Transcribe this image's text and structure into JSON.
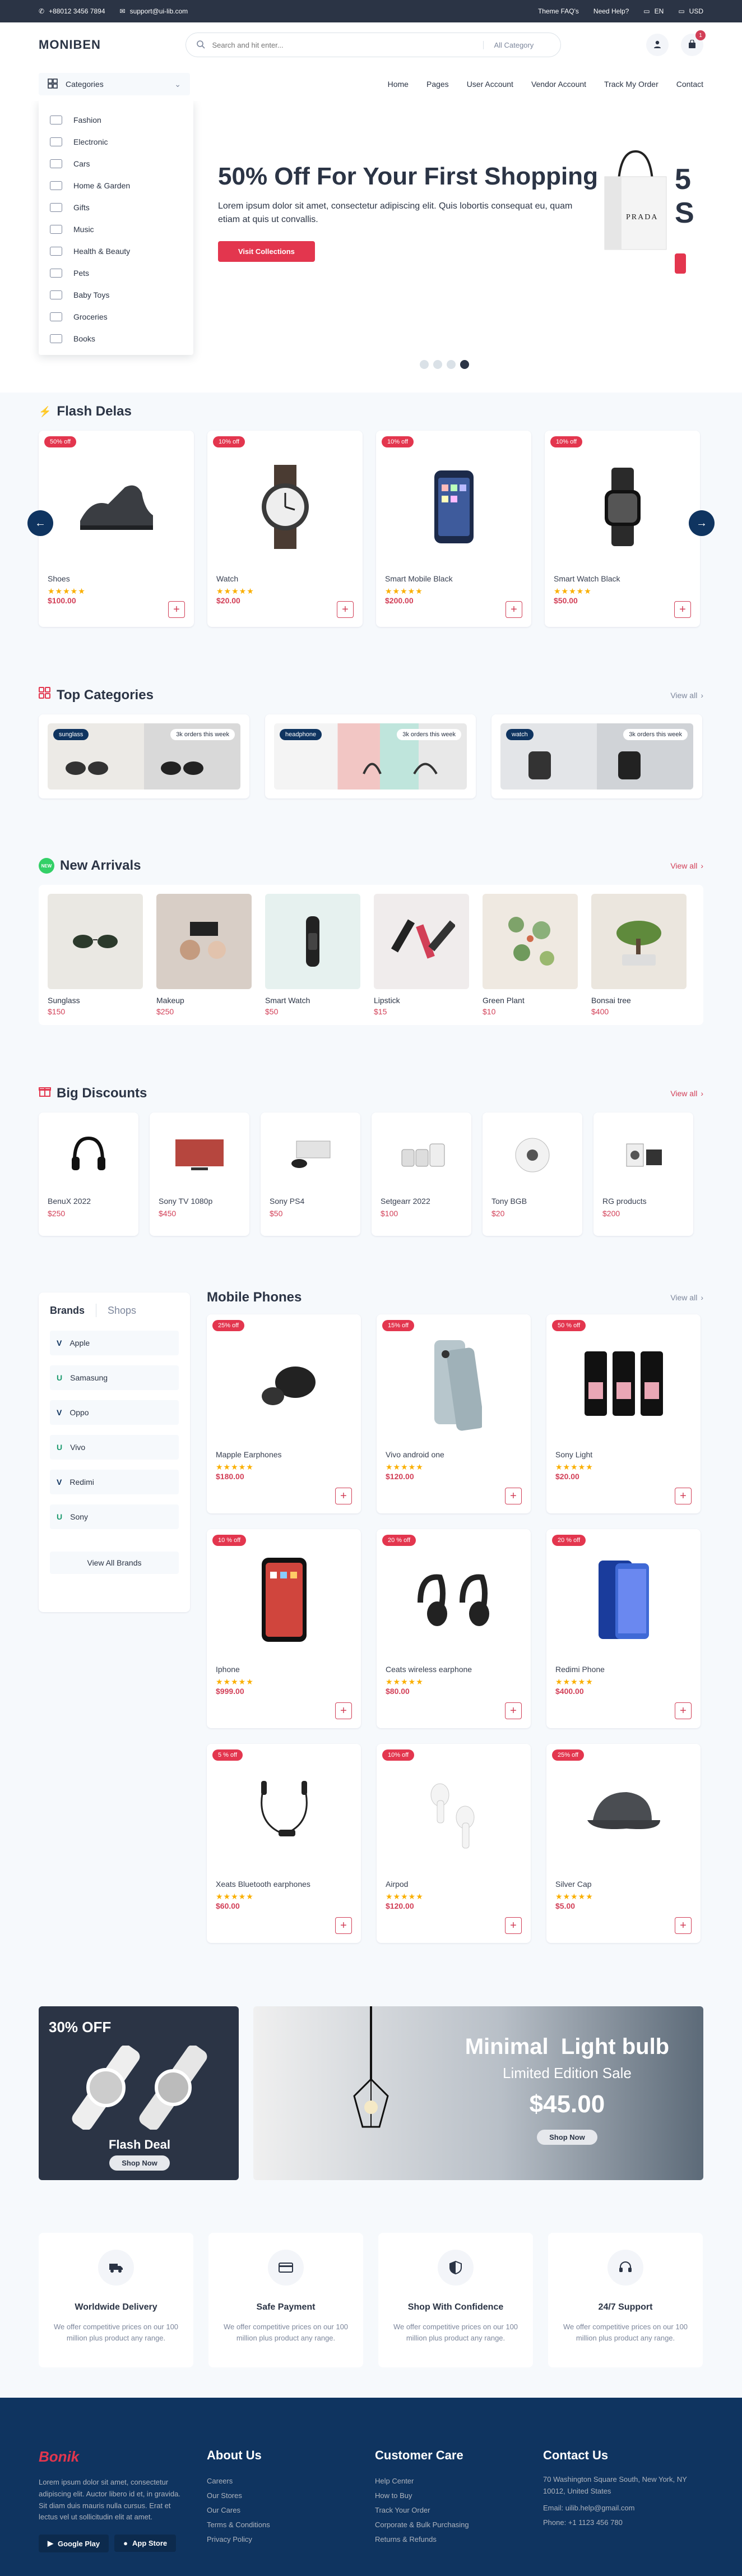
{
  "topbar": {
    "phone": "+88012 3456 7894",
    "email": "support@ui-lib.com",
    "faq": "Theme FAQ's",
    "help": "Need Help?",
    "lang": "EN",
    "currency": "USD"
  },
  "header": {
    "logo": "MONIBEN",
    "search_placeholder": "Search and hit enter...",
    "search_category": "All Category",
    "cart_count": "1"
  },
  "nav": {
    "categories_label": "Categories",
    "links": [
      "Home",
      "Pages",
      "User Account",
      "Vendor Account",
      "Track My Order",
      "Contact"
    ]
  },
  "category_menu": [
    "Fashion",
    "Electronic",
    "Cars",
    "Home & Garden",
    "Gifts",
    "Music",
    "Health & Beauty",
    "Pets",
    "Baby Toys",
    "Groceries",
    "Books"
  ],
  "hero": {
    "title": "50% Off For Your First Shopping",
    "text": "Lorem ipsum dolor sit amet, consectetur adipiscing elit. Quis lobortis consequat eu, quam etiam at quis ut convallis.",
    "button": "Visit Collections",
    "bag_label": "PRADA",
    "next_text": "5\nS"
  },
  "flash": {
    "title": "Flash Delas",
    "items": [
      {
        "discount": "50% off",
        "name": "Shoes",
        "price": "$100.00"
      },
      {
        "discount": "10% off",
        "name": "Watch",
        "price": "$20.00"
      },
      {
        "discount": "10% off",
        "name": "Smart Mobile Black",
        "price": "$200.00"
      },
      {
        "discount": "10% off",
        "name": "Smart Watch Black",
        "price": "$50.00"
      }
    ]
  },
  "top_categories": {
    "title": "Top Categories",
    "view_all": "View all",
    "items": [
      {
        "label": "sunglass",
        "orders": "3k orders this week"
      },
      {
        "label": "headphone",
        "orders": "3k orders this week"
      },
      {
        "label": "watch",
        "orders": "3k orders this week"
      }
    ]
  },
  "new_arrivals": {
    "title": "New Arrivals",
    "view_all": "View all",
    "badge": "NEW",
    "items": [
      {
        "name": "Sunglass",
        "price": "$150"
      },
      {
        "name": "Makeup",
        "price": "$250"
      },
      {
        "name": "Smart Watch",
        "price": "$50"
      },
      {
        "name": "Lipstick",
        "price": "$15"
      },
      {
        "name": "Green Plant",
        "price": "$10"
      },
      {
        "name": "Bonsai tree",
        "price": "$400"
      }
    ]
  },
  "big_discounts": {
    "title": "Big Discounts",
    "view_all": "View all",
    "items": [
      {
        "name": "BenuX 2022",
        "price": "$250"
      },
      {
        "name": "Sony TV 1080p",
        "price": "$450"
      },
      {
        "name": "Sony PS4",
        "price": "$50"
      },
      {
        "name": "Setgearr 2022",
        "price": "$100"
      },
      {
        "name": "Tony BGB",
        "price": "$20"
      },
      {
        "name": "RG products",
        "price": "$200"
      }
    ]
  },
  "brands": {
    "tab_active": "Brands",
    "tab_inactive": "Shops",
    "items": [
      "Apple",
      "Samasung",
      "Oppo",
      "Vivo",
      "Redimi",
      "Sony"
    ],
    "view_all": "View All Brands"
  },
  "mobile": {
    "title": "Mobile Phones",
    "view_all": "View all",
    "items": [
      {
        "discount": "25% off",
        "name": "Mapple Earphones",
        "price": "$180.00"
      },
      {
        "discount": "15% off",
        "name": "Vivo android one",
        "price": "$120.00"
      },
      {
        "discount": "50 % off",
        "name": "Sony Light",
        "price": "$20.00"
      },
      {
        "discount": "10 % off",
        "name": "Iphone",
        "price": "$999.00"
      },
      {
        "discount": "20 % off",
        "name": "Ceats wireless earphone",
        "price": "$80.00"
      },
      {
        "discount": "20 % off",
        "name": "Redimi Phone",
        "price": "$400.00"
      },
      {
        "discount": "5 % off",
        "name": "Xeats Bluetooth earphones",
        "price": "$60.00"
      },
      {
        "discount": "10% off",
        "name": "Airpod",
        "price": "$120.00"
      },
      {
        "discount": "25% off",
        "name": "Silver Cap",
        "price": "$5.00"
      }
    ]
  },
  "banner1": {
    "off": "30% OFF",
    "title": "Flash Deal",
    "button": "Shop Now"
  },
  "banner2": {
    "title": "Minimal  Light bulb",
    "subtitle": "Limited Edition Sale",
    "price": "$45.00",
    "button": "Shop Now"
  },
  "services": [
    {
      "title": "Worldwide Delivery",
      "text": "We offer competitive prices on our 100 million plus product any range."
    },
    {
      "title": "Safe Payment",
      "text": "We offer competitive prices on our 100 million plus product any range."
    },
    {
      "title": "Shop With Confidence",
      "text": "We offer competitive prices on our 100 million plus product any range."
    },
    {
      "title": "24/7 Support",
      "text": "We offer competitive prices on our 100 million plus product any range."
    }
  ],
  "footer": {
    "logo": "Bonik",
    "about_text": "Lorem ipsum dolor sit amet, consectetur adipiscing elit. Auctor libero id et, in gravida. Sit diam duis mauris nulla cursus. Erat et lectus vel ut sollicitudin elit at amet.",
    "google_play": "Google Play",
    "app_store": "App Store",
    "about": {
      "title": "About Us",
      "links": [
        "Careers",
        "Our Stores",
        "Our Cares",
        "Terms & Conditions",
        "Privacy Policy"
      ]
    },
    "care": {
      "title": "Customer Care",
      "links": [
        "Help Center",
        "How to Buy",
        "Track Your Order",
        "Corporate & Bulk Purchasing",
        "Returns & Refunds"
      ]
    },
    "contact": {
      "title": "Contact Us",
      "address": "70 Washington Square South, New York, NY 10012, United States",
      "email": "Email: uilib.help@gmail.com",
      "phone": "Phone: +1 1123 456 780"
    }
  },
  "colors": {
    "primary": "#0f3460",
    "accent": "#e3364e",
    "dark": "#2b3445"
  }
}
